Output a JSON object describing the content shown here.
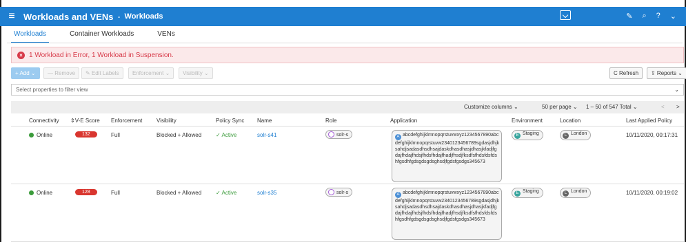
{
  "topbar": {
    "title": "Workloads and VENs",
    "separator": "-",
    "subtitle": "Workloads",
    "icons": [
      "monitor-icon",
      "edit-icon",
      "search-icon",
      "help-icon"
    ]
  },
  "tabs": [
    "Workloads",
    "Container Workloads",
    "VENs"
  ],
  "alert": "1 Workload in Error, 1 Workload in Suspension.",
  "toolbar": {
    "add": "+ Add ⌄",
    "remove": "— Remove",
    "edit_labels": "✎ Edit Labels",
    "enforcement": "Enforcement ⌄",
    "visibility": "Visibility ⌄",
    "refresh": "C Refresh",
    "reports": "⇪ Reports ⌄"
  },
  "filter": {
    "placeholder": "Select properties to filter view"
  },
  "pager": {
    "customize": "Customize columns ⌄",
    "per_page": "50 per page ⌄",
    "range": "1 – 50 of 547 Total ⌄",
    "prev": "<",
    "next": ">"
  },
  "columns": [
    "Connectivity",
    "⇕V-E Score",
    "Enforcement",
    "Visibility",
    "Policy Sync",
    "Name",
    "Role",
    "Application",
    "Environment",
    "Location",
    "Last Applied Policy"
  ],
  "rows": [
    {
      "connectivity": "Online",
      "score": "132",
      "enforcement": "Full",
      "visibility": "Blocked + Allowed",
      "policy_sync": "✓ Active",
      "name": "solr-s41",
      "role": "solr-s",
      "application": "abcdefghijklmnopqrstuvwxyz1234567890abcdefghijklmnopqrstuvw2340123456789sgdasjdhjksahdjsadasdhsdhsajdaskdhasdhasjdhasjkfadjfgdajfhdajfhdsjfhdsfhdajfhadjfhsdjfksdfsfhdsfdsfdshfgsdhfgdsgdsgdsghsdjfgdsfgsdgs345673",
      "environment": "Staging",
      "location": "London",
      "last_applied": "10/11/2020, 00:17:31"
    },
    {
      "connectivity": "Online",
      "score": "128",
      "enforcement": "Full",
      "visibility": "Blocked + Allowed",
      "policy_sync": "✓ Active",
      "name": "solr-s35",
      "role": "solr-s",
      "application": "abcdefghijklmnopqrstuvwxyz1234567890abcdefghijklmnopqrstuvw2340123456789sgdasjdhjksahdjsadasdhsdhsajdaskdhasdhasjdhasjkfadjfgdajfhdajfhdsjfhdsfhdajfhadjfhsdjfksdfsfhdsfdsfdshfgsdhfgdsgdsgdsghsdjfgdsfgsdgs345673",
      "environment": "Staging",
      "location": "London",
      "last_applied": "10/11/2020, 00:19:02"
    }
  ]
}
